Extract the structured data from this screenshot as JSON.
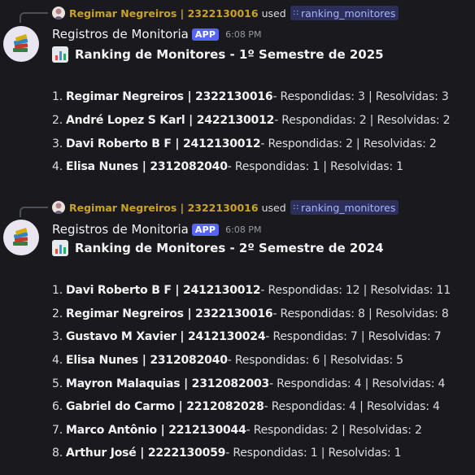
{
  "messages": [
    {
      "reply": {
        "user": "Regimar Negreiros | 2322130016",
        "used": "used",
        "command": "ranking_monitores"
      },
      "author": "Registros de Monitoria",
      "badge": "APP",
      "time": "6:08 PM",
      "title": "Ranking de Monitores - 1º Semestre de 2025",
      "rows": [
        {
          "n": "1.",
          "who": "Regimar Negreiros | 2322130016",
          "rest": " - Respondidas: 3 | Resolvidas: 3"
        },
        {
          "n": "2.",
          "who": "André Lopez S Karl | 2422130012",
          "rest": " - Respondidas: 2 | Resolvidas: 2"
        },
        {
          "n": "3.",
          "who": "Davi Roberto B F | 2412130012",
          "rest": " - Respondidas: 2 | Resolvidas: 2"
        },
        {
          "n": "4.",
          "who": "Elisa Nunes | 2312082040",
          "rest": " - Respondidas: 1 | Resolvidas: 1"
        }
      ]
    },
    {
      "reply": {
        "user": "Regimar Negreiros | 2322130016",
        "used": "used",
        "command": "ranking_monitores"
      },
      "author": "Registros de Monitoria",
      "badge": "APP",
      "time": "6:08 PM",
      "title": "Ranking de Monitores - 2º Semestre de 2024",
      "rows": [
        {
          "n": "1.",
          "who": "Davi Roberto B F | 2412130012",
          "rest": " - Respondidas: 12 | Resolvidas: 11"
        },
        {
          "n": "2.",
          "who": "Regimar Negreiros | 2322130016",
          "rest": " - Respondidas: 8 | Resolvidas: 8"
        },
        {
          "n": "3.",
          "who": "Gustavo M Xavier | 2412130024",
          "rest": " - Respondidas: 7 | Resolvidas: 7"
        },
        {
          "n": "4.",
          "who": "Elisa Nunes | 2312082040",
          "rest": " - Respondidas: 6 | Resolvidas: 5"
        },
        {
          "n": "5.",
          "who": "Mayron Malaquias | 2312082003",
          "rest": " - Respondidas: 4 | Resolvidas: 4"
        },
        {
          "n": "6.",
          "who": "Gabriel do Carmo | 2212082028",
          "rest": " - Respondidas: 4 | Resolvidas: 4"
        },
        {
          "n": "7.",
          "who": "Marco Antônio | 2212130044",
          "rest": " - Respondidas: 2 | Resolvidas: 2"
        },
        {
          "n": "8.",
          "who": "Arthur José | 2222130059",
          "rest": " - Respondidas: 1 | Resolvidas: 1"
        }
      ]
    }
  ],
  "colors": {
    "accent": "#5865f2",
    "reply_name": "#c9a227",
    "command_chip": "#2c2f5a"
  },
  "icons": {
    "bot_avatar": "books-icon",
    "chart": "bar-chart-emoji",
    "reply_avatar": "user-avatar",
    "command": "slash-command-icon"
  }
}
